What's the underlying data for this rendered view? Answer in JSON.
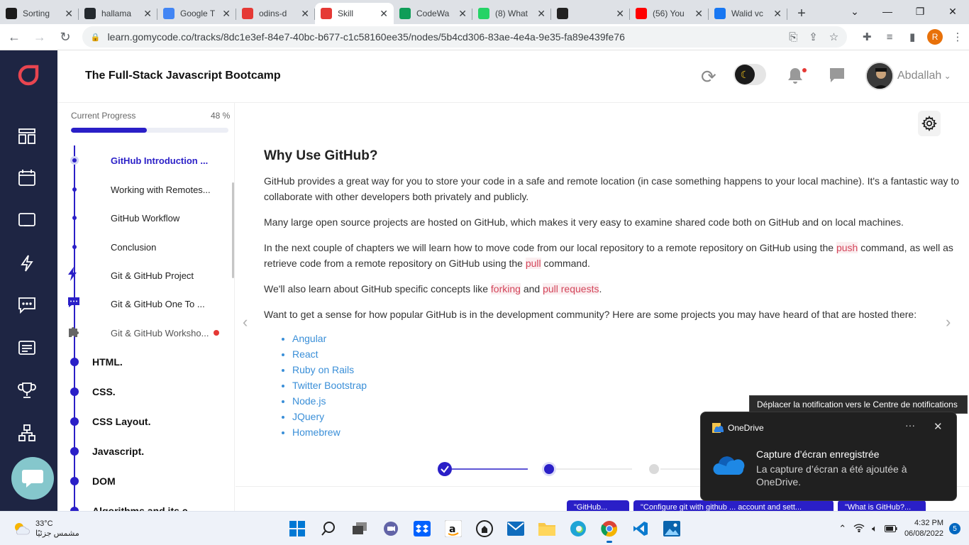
{
  "browser": {
    "tabs": [
      {
        "title": "Sorting",
        "favicon": "VA",
        "color": "#1b1b1b"
      },
      {
        "title": "hallama",
        "favicon": "github",
        "color": "#24292e"
      },
      {
        "title": "Google T",
        "favicon": "G",
        "color": "#4285f4"
      },
      {
        "title": "odins-d",
        "favicon": "o",
        "color": "#e53935"
      },
      {
        "title": "Skill",
        "favicon": "gomycode",
        "color": "#e53935",
        "active": true
      },
      {
        "title": "CodeWa",
        "favicon": "+",
        "color": "#0f9d58"
      },
      {
        "title": "(8) What",
        "favicon": "8",
        "color": "#25d366"
      },
      {
        "title": "",
        "favicon": "media",
        "color": "#222"
      },
      {
        "title": "(56) You",
        "favicon": "yt",
        "color": "#ff0000"
      },
      {
        "title": "Walid vc",
        "favicon": "f",
        "color": "#1877f2"
      }
    ],
    "url": "learn.gomycode.co/tracks/8dc1e3ef-84e7-40bc-b677-c1c58160ee35/nodes/5b4cd306-83ae-4e4a-9e35-fa89e439fe76",
    "profile_initial": "R"
  },
  "app": {
    "title": "The Full-Stack Javascript Bootcamp",
    "user_name": "Abdallah"
  },
  "sidebar": {
    "progress_label": "Current Progress",
    "progress_value": "48 %",
    "progress_fraction": 0.48,
    "items": [
      {
        "label": "GitHub Introduction ...",
        "current": true
      },
      {
        "label": "Working with Remotes..."
      },
      {
        "label": "GitHub Workflow"
      },
      {
        "label": "Conclusion"
      },
      {
        "label": "Git & GitHub Project",
        "icon": "bolt-icon"
      },
      {
        "label": "Git & GitHub One To ...",
        "icon": "chat-icon"
      },
      {
        "label": "Git & GitHub Worksho...",
        "icon": "puzzle-icon"
      }
    ],
    "sections": [
      "HTML.",
      "CSS.",
      "CSS Layout.",
      "Javascript.",
      "DOM",
      "Algorithms and its c..."
    ]
  },
  "content": {
    "heading": "Why Use GitHub?",
    "p1": "GitHub provides a great way for you to store your code in a safe and remote location (in case something happens to your local machine). It's a fantastic way to collaborate with other developers both privately and publicly.",
    "p2": "Many large open source projects are hosted on GitHub, which makes it very easy to examine shared code both on GitHub and on local machines.",
    "p3a": "In the next couple of chapters we will learn how to move code from our local repository to a remote repository on GitHub using the ",
    "p3push": "push",
    "p3b": " command, as well as retrieve code from a remote repository on GitHub using the ",
    "p3pull": "pull",
    "p3c": " command.",
    "p4a": "We'll also learn about GitHub specific concepts like ",
    "p4fork": "forking",
    "p4and": " and ",
    "p4pr": "pull requests",
    "p4end": ".",
    "p5": "Want to get a sense for how popular GitHub is in the development community? Here are some projects you may have heard of that are hosted there:",
    "projects": [
      "Angular",
      "React",
      "Ruby on Rails",
      "Twitter Bootstrap",
      "Node.js",
      "JQuery",
      "Homebrew"
    ],
    "bottom_buttons": [
      "\"GitHub...",
      "\"Configure git with github ... account and sett...",
      "\"What is GitHub?..."
    ]
  },
  "notification": {
    "tooltip": "Déplacer la notification vers le Centre de notifications",
    "app": "OneDrive",
    "title": "Capture d’écran enregistrée",
    "body": "La capture d’écran a été ajoutée à OneDrive."
  },
  "taskbar": {
    "temperature": "33°C",
    "weather_text": "مشمس جزئيًا",
    "time": "4:32 PM",
    "date": "06/08/2022",
    "notification_count": "5"
  },
  "colors": {
    "accent": "#2a1fc7",
    "rail": "#1e2543",
    "link": "#3a8fd8",
    "highlight": "#d3455a"
  }
}
